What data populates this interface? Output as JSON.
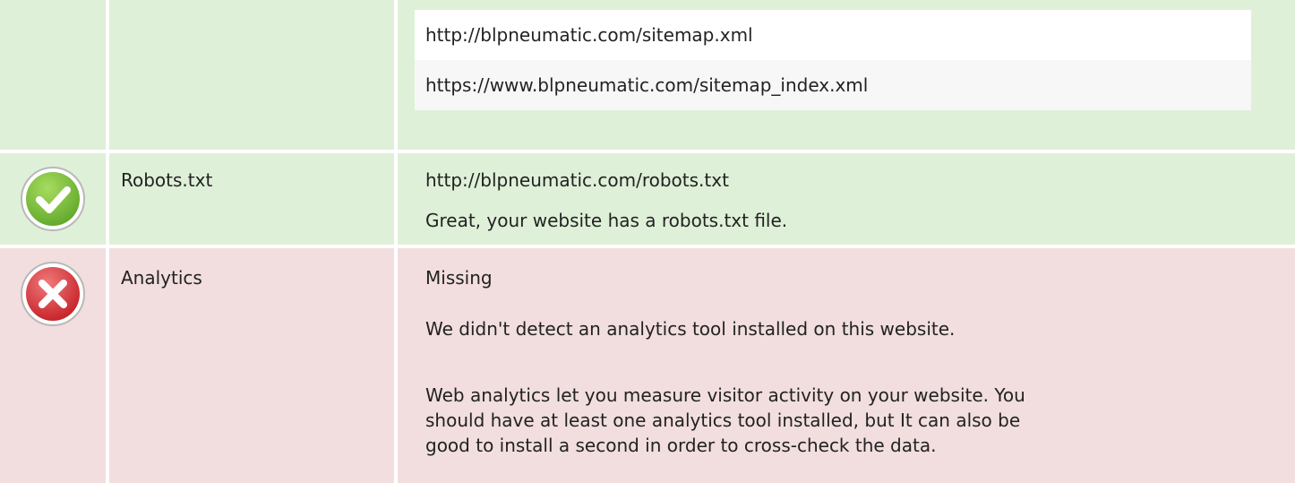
{
  "sitemaps": {
    "items": [
      "http://blpneumatic.com/sitemap.xml",
      "https://www.blpneumatic.com/sitemap_index.xml"
    ]
  },
  "robots": {
    "status": "pass",
    "status_icon": "check-circle-icon",
    "label": "Robots.txt",
    "value": "http://blpneumatic.com/robots.txt",
    "message": "Great, your website has a robots.txt file."
  },
  "analytics": {
    "status": "fail",
    "status_icon": "x-circle-icon",
    "label": "Analytics",
    "value": "Missing",
    "message": "We didn't detect an analytics tool installed on this website.",
    "description_lines": [
      "Web analytics let you measure visitor activity on your website. You",
      "should have at least one analytics tool installed, but It can also be",
      "good to install a second in order to cross-check the data."
    ]
  },
  "colors": {
    "pass_bg": "#dff0d8",
    "fail_bg": "#f2dede",
    "pass_icon": "#7cbe3c",
    "fail_icon": "#d9363e"
  }
}
